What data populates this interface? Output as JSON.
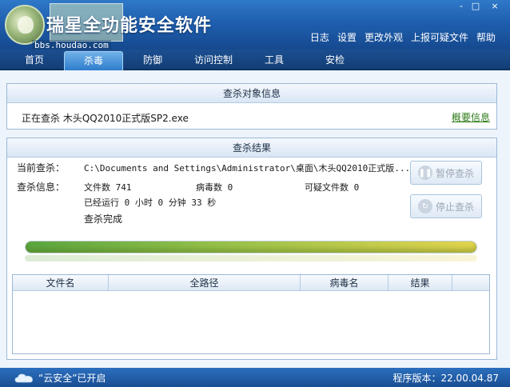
{
  "app": {
    "title": "瑞星全功能安全软件",
    "watermark": "bbs.houdao.com",
    "window_controls": [
      "-",
      "□",
      "×"
    ]
  },
  "top_links": [
    "日志",
    "设置",
    "更改外观",
    "上报可疑文件",
    "帮助"
  ],
  "nav": {
    "tabs": [
      {
        "label": "首页",
        "active": false
      },
      {
        "label": "杀毒",
        "active": true
      },
      {
        "label": "防御",
        "active": false
      },
      {
        "label": "访问控制",
        "active": false
      },
      {
        "label": "工具",
        "active": false
      },
      {
        "label": "安检",
        "active": false
      }
    ]
  },
  "target_panel": {
    "title": "查杀对象信息",
    "scanning_text": "正在查杀 木头QQ2010正式版SP2.exe",
    "summary_link": "概要信息"
  },
  "result_panel": {
    "title": "查杀结果",
    "current_label": "当前查杀：",
    "current_path": "C:\\Documents and Settings\\Administrator\\桌面\\木头QQ2010正式版...",
    "info_label": "查杀信息：",
    "file_count": "文件数 741",
    "virus_count": "病毒数 0",
    "suspicious_count": "可疑文件数 0",
    "elapsed": "已经运行 0 小时 0 分钟 33  秒",
    "status": "查杀完成",
    "pause_button": "暂停查杀",
    "stop_button": "停止查杀",
    "progress": 1.0
  },
  "table": {
    "columns": [
      "文件名",
      "全路径",
      "病毒名",
      "结果"
    ]
  },
  "status_bar": {
    "cloud_text": "“云安全”已开启",
    "version_text": "程序版本：22.00.04.87"
  },
  "colors": {
    "header": "#1f5fae",
    "link_green": "#2b7a17",
    "panel_border": "#9ab8d8"
  }
}
